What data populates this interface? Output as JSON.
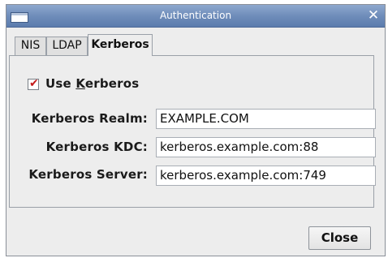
{
  "window": {
    "title": "Authentication",
    "close_glyph": "✕"
  },
  "tabs": [
    {
      "label": "NIS",
      "selected": false
    },
    {
      "label": "LDAP",
      "selected": false
    },
    {
      "label": "Kerberos",
      "selected": true
    }
  ],
  "kerberos": {
    "use_kerberos": {
      "label": "Use Kerberos",
      "mnemonic": "K",
      "checked": true,
      "check_glyph": "✔"
    },
    "realm": {
      "label": "Kerberos Realm:",
      "value": "EXAMPLE.COM"
    },
    "kdc": {
      "label": "Kerberos KDC:",
      "value": "kerberos.example.com:88"
    },
    "server": {
      "label": "Kerberos Server:",
      "value": "kerberos.example.com:749"
    }
  },
  "buttons": {
    "close_label": "Close"
  },
  "colors": {
    "titlebar": "#6f8dba",
    "check": "#c41a1a",
    "window_bg": "#ededed"
  }
}
